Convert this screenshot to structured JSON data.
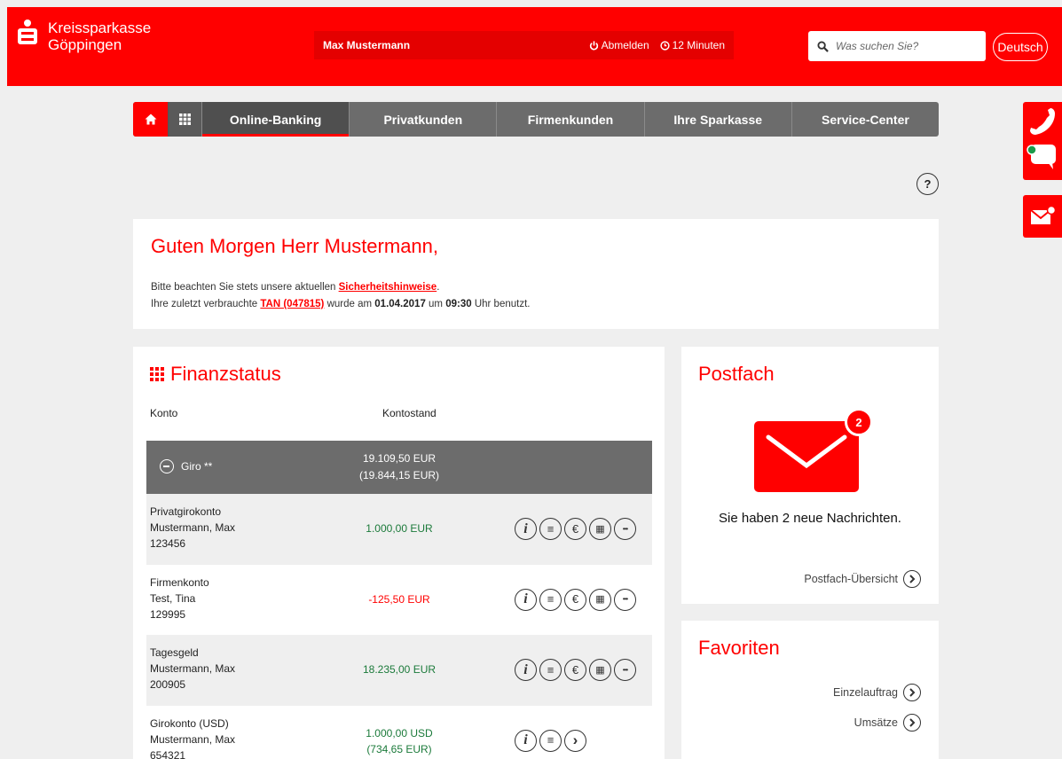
{
  "header": {
    "bank_name_line1": "Kreissparkasse",
    "bank_name_line2": "Göppingen",
    "user_name": "Max Mustermann",
    "logout_label": "Abmelden",
    "session_timer": "12 Minuten",
    "search_placeholder": "Was suchen Sie?",
    "language_label": "Deutsch"
  },
  "nav": {
    "items": [
      "Online-Banking",
      "Privatkunden",
      "Firmenkunden",
      "Ihre Sparkasse",
      "Service-Center"
    ],
    "active_index": 0
  },
  "help_label": "?",
  "greeting": {
    "title": "Guten Morgen Herr Mustermann,",
    "line1_prefix": "Bitte beachten Sie stets unsere aktuellen ",
    "line1_link": "Sicherheitshinweise",
    "line1_suffix": ".",
    "line2_prefix": "Ihre zuletzt verbrauchte ",
    "line2_link": "TAN (047815)",
    "line2_mid": " wurde am ",
    "line2_date": "01.04.2017",
    "line2_mid2": " um ",
    "line2_time": "09:30",
    "line2_suffix": " Uhr benutzt."
  },
  "finanzstatus": {
    "title": "Finanzstatus",
    "col_konto": "Konto",
    "col_kontostand": "Kontostand",
    "group": {
      "label": "Giro **",
      "amount": "19.109,50 EUR",
      "amount_sub": "(19.844,15 EUR)"
    },
    "accounts": [
      {
        "type": "Privatgirokonto",
        "owner": "Mustermann, Max",
        "number": "123456",
        "amount": "1.000,00 EUR",
        "amount_sub": ""
      },
      {
        "type": "Firmenkonto",
        "owner": "Test, Tina",
        "number": "129995",
        "amount": "-125,50 EUR",
        "amount_sub": ""
      },
      {
        "type": "Tagesgeld",
        "owner": "Mustermann, Max",
        "number": "200905",
        "amount": "18.235,00 EUR",
        "amount_sub": ""
      },
      {
        "type": "Girokonto (USD)",
        "owner": "Mustermann, Max",
        "number": "654321",
        "amount": "1.000,00 USD",
        "amount_sub": "(734,65 EUR)"
      }
    ],
    "icons": {
      "info": "i",
      "list": "≡",
      "transfer": "€",
      "calendar": "▦",
      "more": "•••",
      "next": "›"
    }
  },
  "postfach": {
    "title": "Postfach",
    "badge_count": "2",
    "message": "Sie haben 2 neue Nachrichten.",
    "overview_link": "Postfach-Übersicht"
  },
  "favoriten": {
    "title": "Favoriten",
    "links": [
      "Einzelauftrag",
      "Umsätze"
    ]
  },
  "colors": {
    "brand_red": "#ff0000",
    "nav_gray": "#6c6c6c",
    "positive_green": "#1b7a3a"
  }
}
